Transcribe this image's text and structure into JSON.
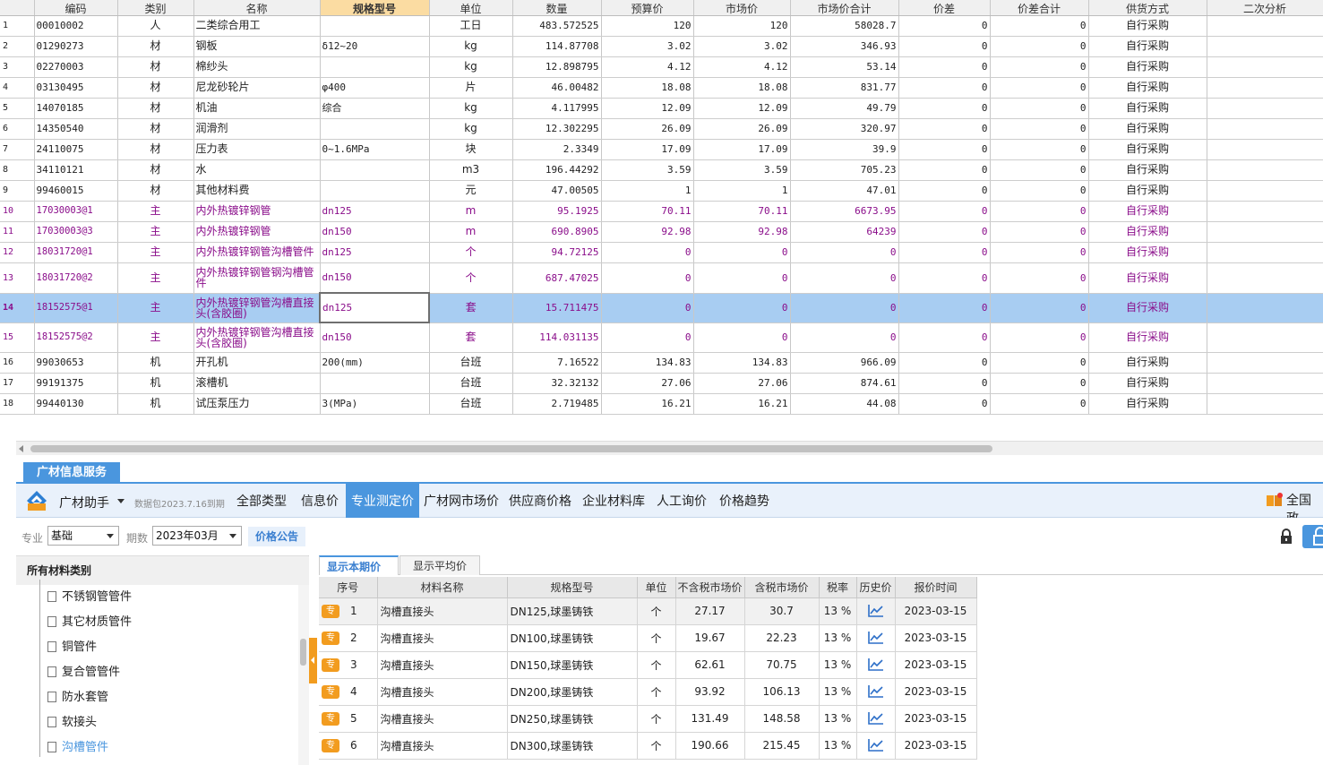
{
  "main_table": {
    "headers": [
      "编码",
      "类别",
      "名称",
      "规格型号",
      "单位",
      "数量",
      "预算价",
      "市场价",
      "市场价合计",
      "价差",
      "价差合计",
      "供货方式",
      "二次分析"
    ],
    "rows": [
      {
        "n": "1",
        "code": "00010002",
        "cat": "人",
        "name": "二类综合用工",
        "spec": "",
        "unit": "工日",
        "qty": "483.572525",
        "budget": "120",
        "market": "120",
        "total": "58028.7",
        "diff": "0",
        "diff_total": "0",
        "supply": "自行采购"
      },
      {
        "n": "2",
        "code": "01290273",
        "cat": "材",
        "name": "钢板",
        "spec": "δ12~20",
        "unit": "kg",
        "qty": "114.87708",
        "budget": "3.02",
        "market": "3.02",
        "total": "346.93",
        "diff": "0",
        "diff_total": "0",
        "supply": "自行采购"
      },
      {
        "n": "3",
        "code": "02270003",
        "cat": "材",
        "name": "棉纱头",
        "spec": "",
        "unit": "kg",
        "qty": "12.898795",
        "budget": "4.12",
        "market": "4.12",
        "total": "53.14",
        "diff": "0",
        "diff_total": "0",
        "supply": "自行采购"
      },
      {
        "n": "4",
        "code": "03130495",
        "cat": "材",
        "name": "尼龙砂轮片",
        "spec": "φ400",
        "unit": "片",
        "qty": "46.00482",
        "budget": "18.08",
        "market": "18.08",
        "total": "831.77",
        "diff": "0",
        "diff_total": "0",
        "supply": "自行采购"
      },
      {
        "n": "5",
        "code": "14070185",
        "cat": "材",
        "name": "机油",
        "spec": "综合",
        "unit": "kg",
        "qty": "4.117995",
        "budget": "12.09",
        "market": "12.09",
        "total": "49.79",
        "diff": "0",
        "diff_total": "0",
        "supply": "自行采购"
      },
      {
        "n": "6",
        "code": "14350540",
        "cat": "材",
        "name": "润滑剂",
        "spec": "",
        "unit": "kg",
        "qty": "12.302295",
        "budget": "26.09",
        "market": "26.09",
        "total": "320.97",
        "diff": "0",
        "diff_total": "0",
        "supply": "自行采购"
      },
      {
        "n": "7",
        "code": "24110075",
        "cat": "材",
        "name": "压力表",
        "spec": "0~1.6MPa",
        "unit": "块",
        "qty": "2.3349",
        "budget": "17.09",
        "market": "17.09",
        "total": "39.9",
        "diff": "0",
        "diff_total": "0",
        "supply": "自行采购"
      },
      {
        "n": "8",
        "code": "34110121",
        "cat": "材",
        "name": "水",
        "spec": "",
        "unit": "m3",
        "qty": "196.44292",
        "budget": "3.59",
        "market": "3.59",
        "total": "705.23",
        "diff": "0",
        "diff_total": "0",
        "supply": "自行采购"
      },
      {
        "n": "9",
        "code": "99460015",
        "cat": "材",
        "name": "其他材料费",
        "spec": "",
        "unit": "元",
        "qty": "47.00505",
        "budget": "1",
        "market": "1",
        "total": "47.01",
        "diff": "0",
        "diff_total": "0",
        "supply": "自行采购"
      },
      {
        "n": "10",
        "code": "17030003@1",
        "cat": "主",
        "name": "内外热镀锌钢管",
        "spec": "dn125",
        "unit": "m",
        "qty": "95.1925",
        "budget": "70.11",
        "market": "70.11",
        "total": "6673.95",
        "diff": "0",
        "diff_total": "0",
        "supply": "自行采购"
      },
      {
        "n": "11",
        "code": "17030003@3",
        "cat": "主",
        "name": "内外热镀锌钢管",
        "spec": "dn150",
        "unit": "m",
        "qty": "690.8905",
        "budget": "92.98",
        "market": "92.98",
        "total": "64239",
        "diff": "0",
        "diff_total": "0",
        "supply": "自行采购"
      },
      {
        "n": "12",
        "code": "18031720@1",
        "cat": "主",
        "name": "内外热镀锌钢管沟槽管件",
        "spec": "dn125",
        "unit": "个",
        "qty": "94.72125",
        "budget": "0",
        "market": "0",
        "total": "0",
        "diff": "0",
        "diff_total": "0",
        "supply": "自行采购"
      },
      {
        "n": "13",
        "code": "18031720@2",
        "cat": "主",
        "name": "内外热镀锌钢管钢沟槽管件",
        "spec": "dn150",
        "unit": "个",
        "qty": "687.47025",
        "budget": "0",
        "market": "0",
        "total": "0",
        "diff": "0",
        "diff_total": "0",
        "supply": "自行采购"
      },
      {
        "n": "14",
        "code": "18152575@1",
        "cat": "主",
        "name": "内外热镀锌钢管沟槽直接头(含胶圈)",
        "spec": "dn125",
        "unit": "套",
        "qty": "15.711475",
        "budget": "0",
        "market": "0",
        "total": "0",
        "diff": "0",
        "diff_total": "0",
        "supply": "自行采购"
      },
      {
        "n": "15",
        "code": "18152575@2",
        "cat": "主",
        "name": "内外热镀锌钢管沟槽直接头(含胶圈)",
        "spec": "dn150",
        "unit": "套",
        "qty": "114.031135",
        "budget": "0",
        "market": "0",
        "total": "0",
        "diff": "0",
        "diff_total": "0",
        "supply": "自行采购"
      },
      {
        "n": "16",
        "code": "99030653",
        "cat": "机",
        "name": "开孔机",
        "spec": "200(mm)",
        "unit": "台班",
        "qty": "7.16522",
        "budget": "134.83",
        "market": "134.83",
        "total": "966.09",
        "diff": "0",
        "diff_total": "0",
        "supply": "自行采购"
      },
      {
        "n": "17",
        "code": "99191375",
        "cat": "机",
        "name": "滚槽机",
        "spec": "",
        "unit": "台班",
        "qty": "32.32132",
        "budget": "27.06",
        "market": "27.06",
        "total": "874.61",
        "diff": "0",
        "diff_total": "0",
        "supply": "自行采购"
      },
      {
        "n": "18",
        "code": "99440130",
        "cat": "机",
        "name": "试压泵压力",
        "spec": "3(MPa)",
        "unit": "台班",
        "qty": "2.719485",
        "budget": "16.21",
        "market": "16.21",
        "total": "44.08",
        "diff": "0",
        "diff_total": "0",
        "supply": "自行采购"
      }
    ]
  },
  "service": {
    "tab_label": "广材信息服务",
    "brand": "广材助手",
    "package_note": "数据包2023.7.16到期",
    "nav": [
      "全部类型",
      "信息价",
      "专业测定价",
      "广材网市场价",
      "供应商价格",
      "企业材料库",
      "人工询价",
      "价格趋势"
    ],
    "region": "全国政",
    "colors": {
      "accent": "#4a96de",
      "badge": "#f29c1f",
      "main_row_text": "#8a0d8a",
      "selected_row": "#a8cdf2"
    }
  },
  "filter": {
    "specialty_label": "专业",
    "specialty_value": "基础",
    "period_label": "期数",
    "period_value": "2023年03月",
    "notice_button": "价格公告"
  },
  "category_panel": {
    "title": "所有材料类别",
    "items": [
      "不锈钢管管件",
      "其它材质管件",
      "铜管件",
      "复合管管件",
      "防水套管",
      "软接头",
      "沟槽管件"
    ]
  },
  "price_panel": {
    "subtabs": [
      "显示本期价格",
      "显示平均价"
    ],
    "headers": [
      "序号",
      "材料名称",
      "规格型号",
      "单位",
      "不含税市场价",
      "含税市场价",
      "税率",
      "历史价",
      "报价时间"
    ],
    "badge": "专",
    "rows": [
      {
        "n": "1",
        "name": "沟槽直接头",
        "spec": "DN125,球墨铸铁",
        "unit": "个",
        "price_ex": "27.17",
        "price_in": "30.7",
        "tax": "13 %",
        "date": "2023-03-15"
      },
      {
        "n": "2",
        "name": "沟槽直接头",
        "spec": "DN100,球墨铸铁",
        "unit": "个",
        "price_ex": "19.67",
        "price_in": "22.23",
        "tax": "13 %",
        "date": "2023-03-15"
      },
      {
        "n": "3",
        "name": "沟槽直接头",
        "spec": "DN150,球墨铸铁",
        "unit": "个",
        "price_ex": "62.61",
        "price_in": "70.75",
        "tax": "13 %",
        "date": "2023-03-15"
      },
      {
        "n": "4",
        "name": "沟槽直接头",
        "spec": "DN200,球墨铸铁",
        "unit": "个",
        "price_ex": "93.92",
        "price_in": "106.13",
        "tax": "13 %",
        "date": "2023-03-15"
      },
      {
        "n": "5",
        "name": "沟槽直接头",
        "spec": "DN250,球墨铸铁",
        "unit": "个",
        "price_ex": "131.49",
        "price_in": "148.58",
        "tax": "13 %",
        "date": "2023-03-15"
      },
      {
        "n": "6",
        "name": "沟槽直接头",
        "spec": "DN300,球墨铸铁",
        "unit": "个",
        "price_ex": "190.66",
        "price_in": "215.45",
        "tax": "13 %",
        "date": "2023-03-15"
      }
    ]
  }
}
